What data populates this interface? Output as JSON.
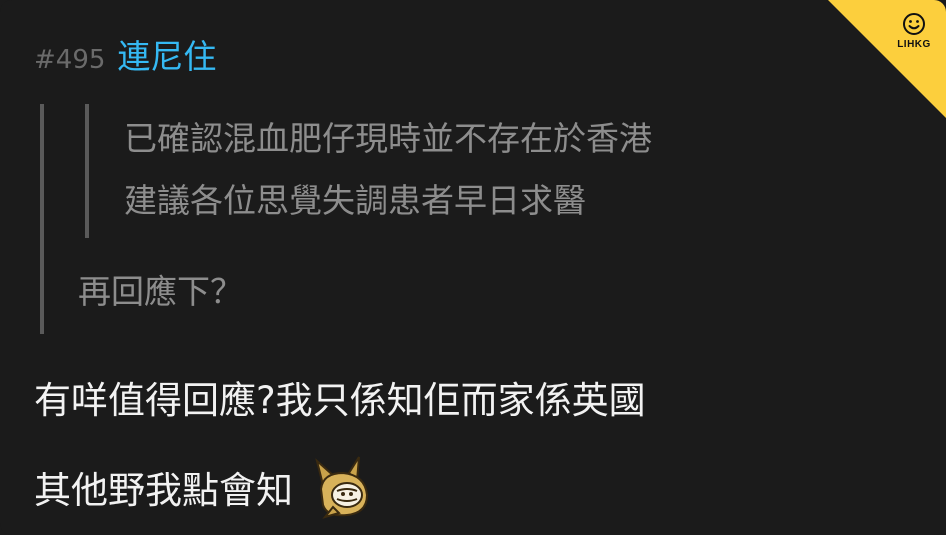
{
  "post": {
    "floor": "#495",
    "username": "連尼住",
    "quote": {
      "nested_lines": [
        "已確認混血肥仔現時並不存在於香港",
        "建議各位思覺失調患者早日求醫"
      ],
      "text": "再回應下？"
    },
    "reply": {
      "lines": [
        "有咩值得回應?我只係知佢而家係英國",
        "其他野我點會知"
      ]
    },
    "emoji": "laughing-dog-emoticon"
  },
  "brand": {
    "label": "LIHKG",
    "icon": "smiley-icon",
    "color": "#fccf3d"
  },
  "colors": {
    "background": "#1b1b1b",
    "username": "#35b9f3",
    "quote_text": "#8d8d8d",
    "body_text": "#f2f2f2"
  }
}
